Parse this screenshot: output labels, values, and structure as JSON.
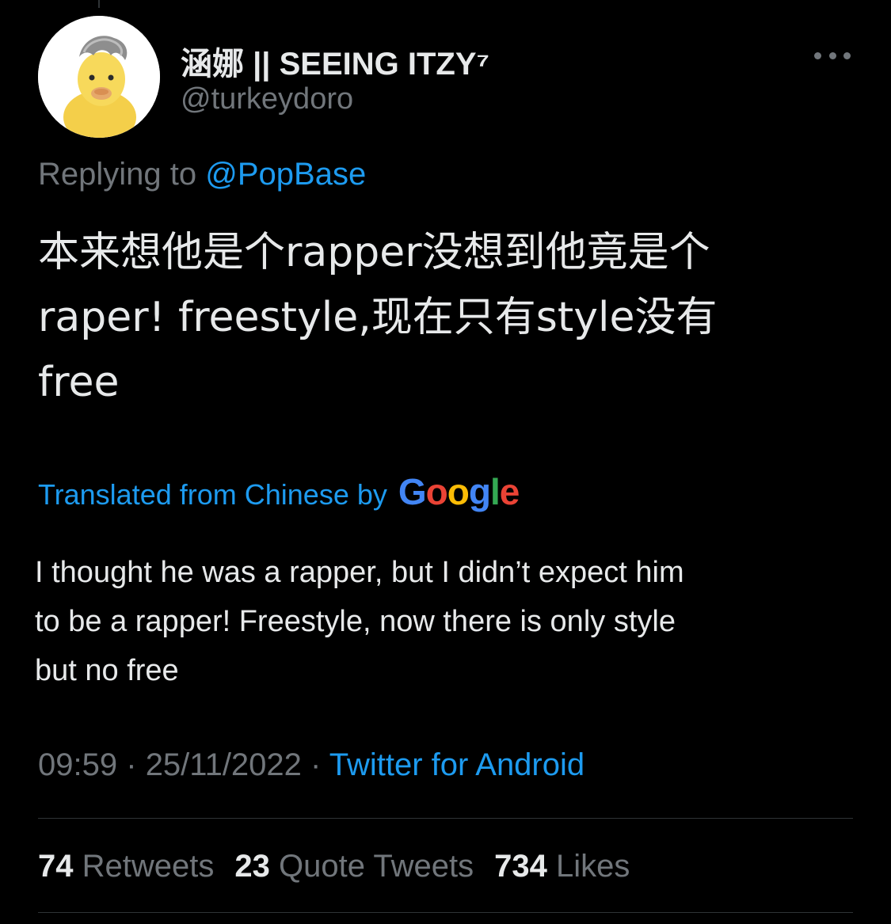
{
  "author": {
    "display_name": "涵娜 || SEEING ITZY⁷",
    "handle": "@turkeydoro",
    "avatar_icon": "duckling-avatar"
  },
  "reply": {
    "prefix": "Replying to",
    "mention": "@PopBase"
  },
  "tweet": {
    "lines": [
      "本来想他是个rapper没想到他竟是个",
      "raper! freestyle,现在只有style没有",
      "free"
    ]
  },
  "translation": {
    "label": "Translated from Chinese by",
    "provider": "Google",
    "provider_colors": [
      "#4285f4",
      "#ea4335",
      "#fbbc05",
      "#4285f4",
      "#34a853",
      "#ea4335"
    ],
    "lines": [
      "I thought he was a rapper, but I didn’t expect him",
      "to be a rapper! Freestyle, now there is only style",
      "but no free"
    ]
  },
  "meta": {
    "time": "09:59",
    "date": "25/11/2022",
    "separator": "·",
    "source": "Twitter for Android"
  },
  "stats": {
    "retweets": "74",
    "retweets_label": "Retweets",
    "quotes": "23",
    "quotes_label": "Quote Tweets",
    "likes": "734",
    "likes_label": "Likes"
  },
  "colors": {
    "background": "#000000",
    "text": "#e7e9ea",
    "secondary": "#71767b",
    "accent": "#1d9bf0",
    "divider": "#2f3336"
  }
}
